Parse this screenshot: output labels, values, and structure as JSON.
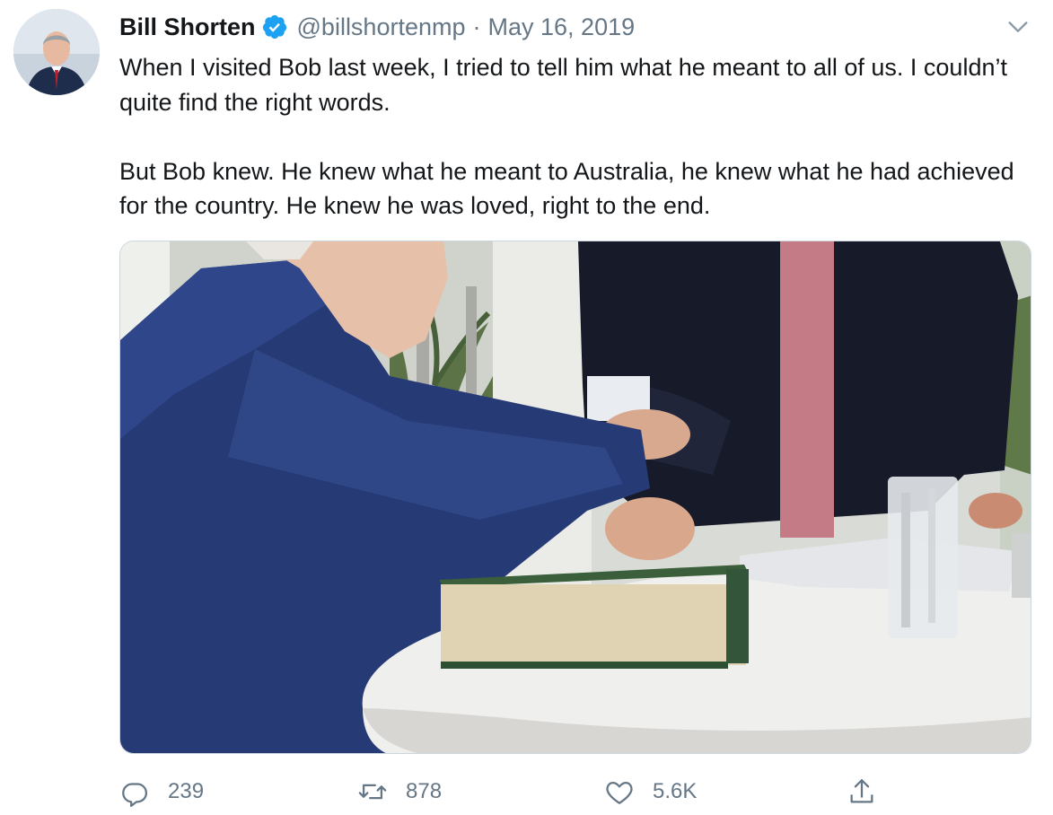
{
  "tweet": {
    "author_name": "Bill Shorten",
    "handle": "@billshortenmp",
    "separator": "·",
    "date": "May 16, 2019",
    "paragraphs": [
      "When I visited Bob last week, I tried to tell him what he meant to all of us. I couldn’t quite find the right words.",
      "But Bob knew. He knew what he meant to Australia, he knew what he had achieved for the country. He knew he was loved, right to the end."
    ]
  },
  "actions": {
    "replies": "239",
    "retweets": "878",
    "likes": "5.6K"
  },
  "icons": [
    "verified-badge-icon",
    "chevron-down-icon",
    "reply-icon",
    "retweet-icon",
    "like-icon",
    "share-icon"
  ],
  "colors": {
    "text": "#14171a",
    "secondary": "#657786",
    "verified": "#1da1f2",
    "border": "#ccd6dd"
  }
}
